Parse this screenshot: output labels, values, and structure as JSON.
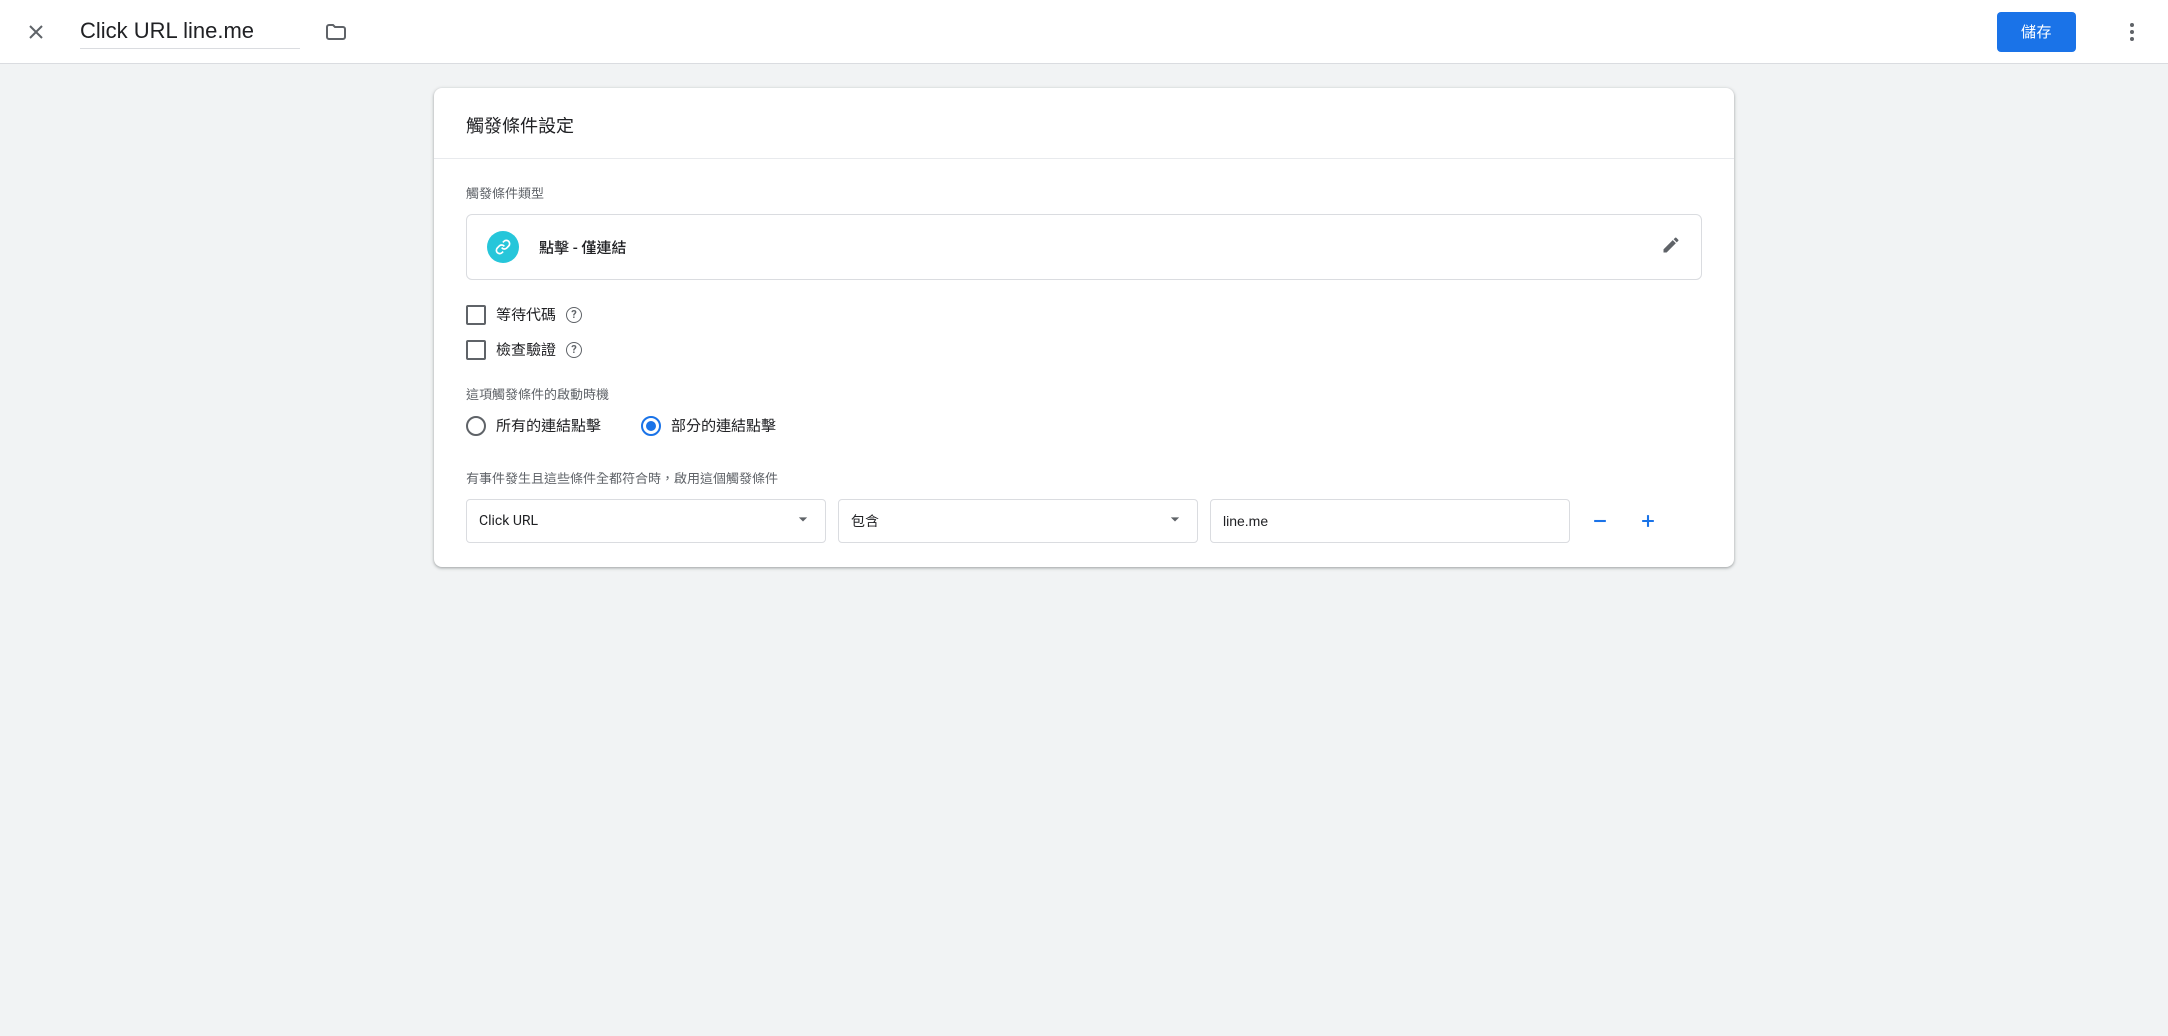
{
  "header": {
    "title": "Click URL line.me",
    "save_label": "儲存"
  },
  "card": {
    "title": "觸發條件設定",
    "type_section_label": "觸發條件類型",
    "type_name": "點擊 - 僅連結",
    "checkbox_wait": "等待代碼",
    "checkbox_check": "檢查驗證",
    "timing_label": "這項觸發條件的啟動時機",
    "radio_all": "所有的連結點擊",
    "radio_some": "部分的連結點擊",
    "condition_label": "有事件發生且這些條件全都符合時，啟用這個觸發條件",
    "condition_variable": "Click URL",
    "condition_operator": "包含",
    "condition_value": "line.me"
  }
}
